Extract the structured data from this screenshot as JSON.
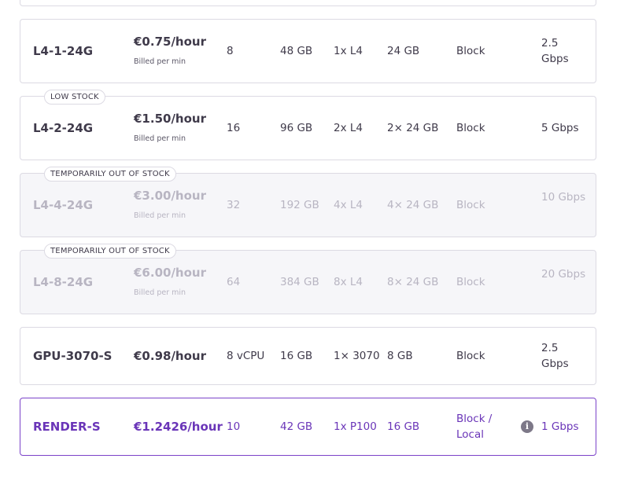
{
  "offers": [
    {
      "name": "L4-1-24G",
      "price": "€0.75/hour",
      "billed": "Billed per min",
      "cpu": "8",
      "ram": "48 GB",
      "gpu": "1x L4",
      "vram": "24 GB",
      "storage": "Block",
      "bandwidth": "2.5 Gbps",
      "badge": "",
      "status": "available"
    },
    {
      "name": "L4-2-24G",
      "price": "€1.50/hour",
      "billed": "Billed per min",
      "cpu": "16",
      "ram": "96 GB",
      "gpu": "2x L4",
      "vram": "2× 24 GB",
      "storage": "Block",
      "bandwidth": "5 Gbps",
      "badge": "LOW STOCK",
      "status": "available"
    },
    {
      "name": "L4-4-24G",
      "price": "€3.00/hour",
      "billed": "Billed per min",
      "cpu": "32",
      "ram": "192 GB",
      "gpu": "4x L4",
      "vram": "4× 24 GB",
      "storage": "Block",
      "bandwidth": "10 Gbps",
      "badge": "TEMPORARILY OUT OF STOCK",
      "status": "out-of-stock"
    },
    {
      "name": "L4-8-24G",
      "price": "€6.00/hour",
      "billed": "Billed per min",
      "cpu": "64",
      "ram": "384 GB",
      "gpu": "8x L4",
      "vram": "8× 24 GB",
      "storage": "Block",
      "bandwidth": "20 Gbps",
      "badge": "TEMPORARILY OUT OF STOCK",
      "status": "out-of-stock"
    },
    {
      "name": "GPU-3070-S",
      "price": "€0.98/hour",
      "billed": "",
      "cpu": "8 vCPU",
      "ram": "16 GB",
      "gpu": "1× 3070",
      "vram": "8 GB",
      "storage": "Block",
      "bandwidth": "2.5 Gbps",
      "badge": "",
      "status": "available"
    },
    {
      "name": "RENDER-S",
      "price": "€1.2426/hour",
      "billed": "",
      "cpu": "10",
      "ram": "42 GB",
      "gpu": "1x P100",
      "vram": "16 GB",
      "storage": "Block / Local",
      "bandwidth": "1 Gbps",
      "badge": "",
      "status": "selected",
      "info_icon": "info-icon"
    }
  ]
}
